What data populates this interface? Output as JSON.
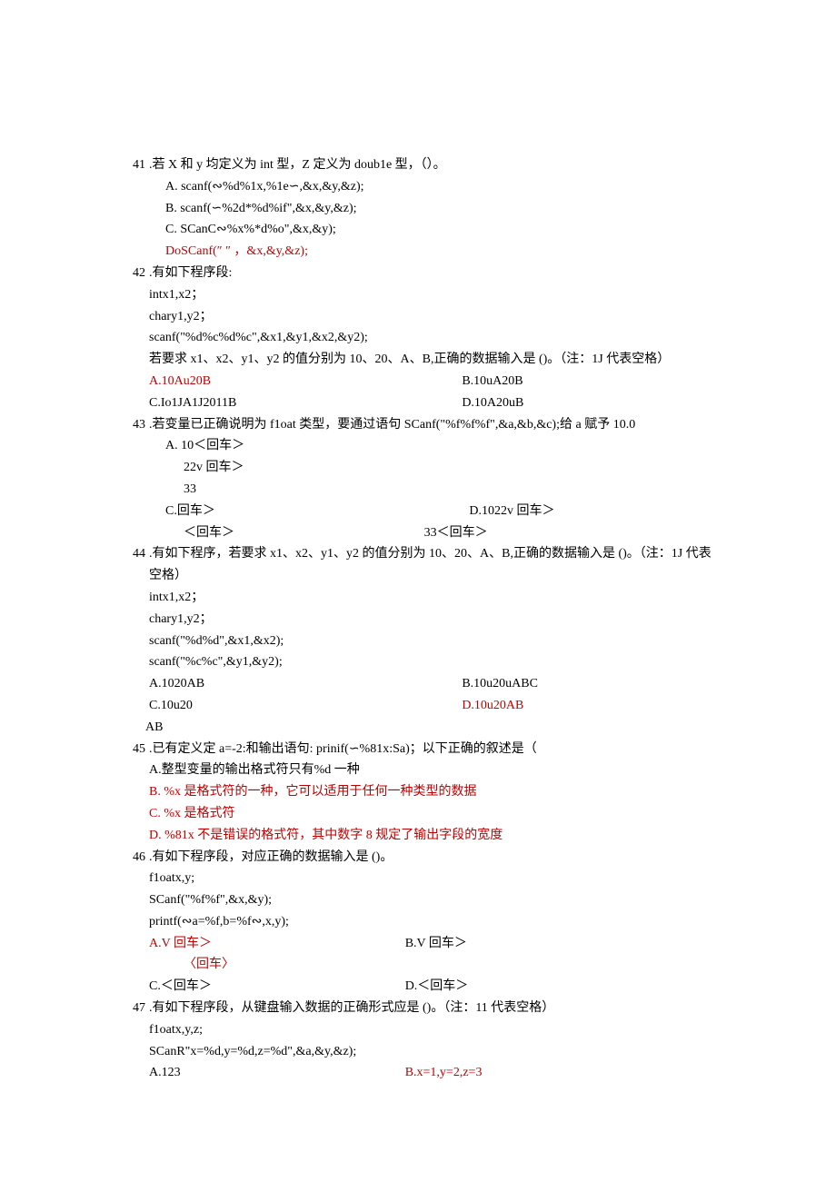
{
  "q41": {
    "num": "41",
    "stem": ".若 X 和 y 均定义为 int 型，Z 定义为 doub1e 型，（）。",
    "a": "A.   scanf(∾%d%1x,%1e∽,&x,&y,&z);",
    "b": "B.   scanf(∽%2d*%d%if\",&x,&y,&z);",
    "c": "C.   SCanC∾%x%*d%o\",&x,&y);",
    "d": "DoSCanf(″ ″ ，&x,&y,&z);"
  },
  "q42": {
    "num": "42",
    "stem": ".有如下程序段:",
    "l1": "intx1,x2；",
    "l2": "chary1,y2；",
    "l3": "scanf(\"%d%c%d%c\",&x1,&y1,&x2,&y2);",
    "l4": "若要求 x1、x2、y1、y2 的值分别为 10、20、A、B,正确的数据输入是 ()。（注：1J 代表空格）",
    "a": "A.10Au20B",
    "b": "B.10uA20B",
    "c": "C.Io1JA1J2011B",
    "d": "D.10A20uB"
  },
  "q43": {
    "num": "43",
    "stem": ".若变量已正确说明为 f1oat 类型，要通过语句 SCanf(\"%f%f%f\",&a,&b,&c);给 a 赋予 10.0",
    "a": "A.    10＜回车＞",
    "a2": "22v 回车＞",
    "a3": "33",
    "c": "C.回车＞",
    "d": "D.1022v 回车＞",
    "c2": "＜回车＞",
    "d2": "33＜回车＞"
  },
  "q44": {
    "num": "44",
    "stem": ".有如下程序，若要求 x1、x2、y1、y2 的值分别为 10、20、A、B,正确的数据输入是 ()。（注：1J 代表空格）",
    "l1": "intx1,x2；",
    "l2": "chary1,y2；",
    "l3": "scanf(\"%d%d\",&x1,&x2);",
    "l4": "scanf(\"%c%c\",&y1,&y2);",
    "a": "A.1020AB",
    "b": "B.10u20uABC",
    "c": "C.10u20",
    "c2": "AB",
    "d": "D.10u20AB"
  },
  "q45": {
    "num": "45",
    "stem": ".已有定义定 a=-2:和输出语句: prinif(∽%81x:Sa)；以下正确的叙述是（",
    "a": "A.整型变量的输出格式符只有%d 一种",
    "b": "B.   %x 是格式符的一种，它可以适用于任何一种类型的数据",
    "c": "C.   %x 是格式符",
    "d": "D.   %81x 不是错误的格式符，其中数字 8 规定了输出字段的宽度"
  },
  "q46": {
    "num": "46",
    "stem": ".有如下程序段，对应正确的数据输入是 ()。",
    "l1": "f1oatx,y;",
    "l2": "SCanf(\"%f%f\",&x,&y);",
    "l3": "printf(∾a=%f,b=%f∾,x,y);",
    "a": "A.V 回车＞",
    "b": "B.V 回车＞",
    "a2": "〈回车〉",
    "c": "C.＜回车＞",
    "d": "D.＜回车＞"
  },
  "q47": {
    "num": "47",
    "stem": ".有如下程序段，从键盘输入数据的正确形式应是 ()。（注：11 代表空格）",
    "l1": "f1oatx,y,z;",
    "l2": "SCanR\"x=%d,y=%d,z=%d\",&a,&y,&z);",
    "a": "A.123",
    "b": "B.x=1,y=2,z=3"
  }
}
